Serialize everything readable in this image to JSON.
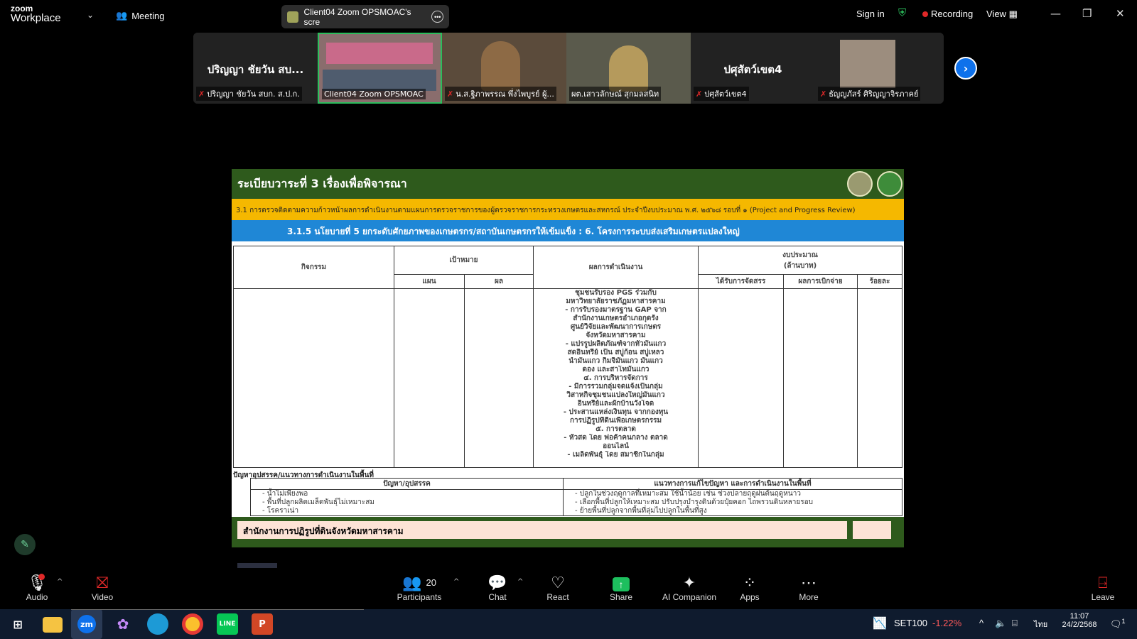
{
  "app": {
    "logo_line1": "zoom",
    "logo_line2": "Workplace",
    "meeting_label": "Meeting",
    "share_title": "Client04 Zoom OPSMOAC's scre",
    "sign_in": "Sign in",
    "recording": "Recording",
    "view": "View"
  },
  "participants_strip": {
    "tiles": [
      {
        "big": "ปริญญา ชัยวัน สบ...",
        "caption": "ปริญญา ชัยวัน สบก. ส.ป.ก."
      },
      {
        "big": "",
        "caption": "Client04 Zoom OPSMOAC"
      },
      {
        "big": "",
        "caption": "น.ส.ฐิภาพรรณ พึ่งไพบูรย์ ผู้..."
      },
      {
        "big": "",
        "caption": "ผต.เสาวลักษณ์ สุกมลสนิท"
      },
      {
        "big": "ปศุสัตว์เขต4",
        "caption": "ปศุสัตว์เขต4"
      },
      {
        "big": "",
        "caption": "ธัญญภัสร์ ศิริญญาจิรภาคย์"
      }
    ]
  },
  "slide": {
    "title": "ระเบียบวาระที่ 3 เรื่องเพื่อพิจารณา",
    "sub1": "3.1 การตรวจติดตามความก้าวหน้าผลการดำเนินงานตามแผนการตรวจราชการของผู้ตรวจราชการกระทรวงเกษตรและสหกรณ์ ประจำปีงบประมาณ พ.ศ. ๒๕๖๘ รอบที่ ๑ (Project and Progress Review)",
    "sub2": "3.1.5 นโยบายที่ 5 ยกระดับศักยภาพของเกษตรกร/สถาบันเกษตรกรให้เข้มแข็ง : 6. โครงการระบบส่งเสริมเกษตรแปลงใหญ่",
    "headers": {
      "activity": "กิจกรรม",
      "target": "เป้าหมาย",
      "plan": "แผน",
      "result": "ผล",
      "performance": "ผลการดำเนินงาน",
      "budget": "งบประมาณ",
      "budget_unit": "(ล้านบาท)",
      "allocated": "ได้รับการจัดสรร",
      "disbursed": "ผลการเบิกจ่าย",
      "percent": "ร้อยละ"
    },
    "results_lines": [
      "ชุมชนรับรอง PGS ร่วมกับ",
      "มหาวิทยาลัยราชภัฏมหาสารคาม",
      "- การรับรองมาตรฐาน GAP จาก",
      "สำนักงานเกษตรอำเภอกุดรัง",
      "ศูนย์วิจัยและพัฒนาการเกษตร",
      "จังหวัดมหาสารคาม",
      "- แปรรูปผลิตภัณฑ์จากหัวมันแกว",
      "สดอินทรีย์ เป็น สบู่ก้อน สบู่เหลว",
      "น้ำมันแกว กิมจิมันแกว มันแกว",
      "ดอง และสาโทมันแกว",
      "๔. การบริหารจัดการ",
      "- มีการรวมกลุ่มจดแจ้งเป็นกลุ่ม",
      "วิสาหกิจชุมชนแปลงใหญ่มันแกว",
      "อินทรีย์และผักบ้านวังโจด",
      "- ประสานแหล่งเงินทุน จากกองทุน",
      "การปฏิรูปที่ดินเพื่อเกษตรกรรม",
      "๕. การตลาด",
      "- หัวสด โดย พ่อค้าคนกลาง ตลาด",
      "ออนไลน์",
      "- เมล็ดพันธุ์ โดย สมาชิกในกลุ่ม"
    ],
    "problem_label": "ปัญหาอุปสรรค/แนวทางการดำเนินงานในพื้นที่",
    "problem_header": "ปัญหา/อุปสรรค",
    "solution_header": "แนวทางการแก้ไขปัญหา และการดำเนินงานในพื้นที่",
    "problems": [
      "- น้ำไม่เพียงพอ",
      "- พื้นที่ปลูกผลิตเมล็ดพันธุ์ไม่เหมาะสม",
      "- โรคราเน่า"
    ],
    "solutions": [
      "- ปลูกในช่วงฤดูกาลที่เหมาะสม ใช้น้ำน้อย เช่น ช่วงปลายฤดูฝนต้นฤดูหนาว",
      "- เลือกพื้นที่ปลูกให้เหมาะสม ปรับปรุงบำรุงดินด้วยปุ๋ยคอก ไถพรวนดินหลายรอบ",
      "- ย้ายพื้นที่ปลูกจากพื้นที่ลุ่มไปปลูกในพื้นที่สูง"
    ],
    "footer": "สำนักงานการปฏิรูปที่ดินจังหวัดมหาสารคาม"
  },
  "toolbar": {
    "audio": "Audio",
    "video": "Video",
    "participants": "Participants",
    "participants_count": "20",
    "chat": "Chat",
    "react": "React",
    "share": "Share",
    "ai": "AI Companion",
    "apps": "Apps",
    "more": "More",
    "leave": "Leave"
  },
  "taskbar": {
    "stock_name": "SET100",
    "stock_change": "-1.22%",
    "lang": "ไทย",
    "time": "11:07",
    "date": "24/2/2568",
    "notif": "1"
  },
  "colors": {
    "zoom_blue": "#0e71eb",
    "slide_green": "#2e5a1c",
    "slide_yellow": "#f5b800",
    "slide_blue": "#1f87d6",
    "stock_red": "#ff5a5a"
  }
}
